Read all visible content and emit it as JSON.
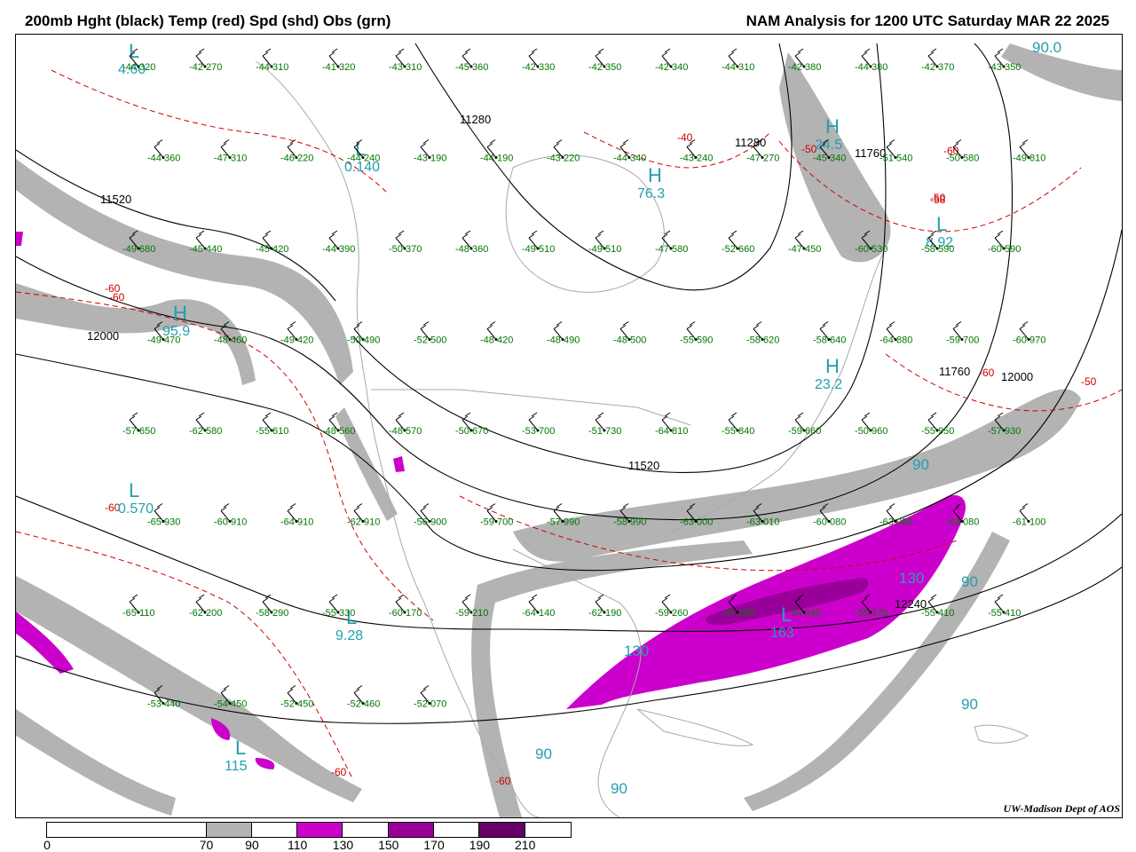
{
  "header": {
    "left_title": "200mb Hght (black) Temp (red) Spd (shd) Obs (grn)",
    "right_title": "NAM Analysis for 1200 UTC Saturday  MAR 22 2025"
  },
  "credit": "UW-Madison  Dept of AOS",
  "colors": {
    "height": "#000000",
    "temperature": "#cc0000",
    "obs": "#007700",
    "speed_label": "#22a0b0",
    "shade_70": "#b3b3b3",
    "shade_110": "#cc00cc",
    "shade_150": "#990099",
    "shade_190": "#660066",
    "geography": "#a8a8a8"
  },
  "colorbar": {
    "labels": [
      "0",
      "70",
      "90",
      "110",
      "130",
      "150",
      "170",
      "190",
      "210"
    ],
    "bins": [
      {
        "from": 0,
        "to": 70,
        "color": "#ffffff"
      },
      {
        "from": 70,
        "to": 90,
        "color": "#b3b3b3"
      },
      {
        "from": 90,
        "to": 110,
        "color": "#ffffff"
      },
      {
        "from": 110,
        "to": 130,
        "color": "#cc00cc"
      },
      {
        "from": 130,
        "to": 150,
        "color": "#ffffff"
      },
      {
        "from": 150,
        "to": 170,
        "color": "#990099"
      },
      {
        "from": 170,
        "to": 190,
        "color": "#ffffff"
      },
      {
        "from": 190,
        "to": 210,
        "color": "#660066"
      },
      {
        "from": 210,
        "to": 230,
        "color": "#ffffff"
      }
    ]
  },
  "height_labels": [
    "11280",
    "11280",
    "11520",
    "11520",
    "11760",
    "11760",
    "12000",
    "12000",
    "12240"
  ],
  "temp_labels": [
    "-60",
    "-60",
    "-60",
    "-60",
    "-60",
    "-60",
    "-50",
    "-50",
    "-40",
    "-50",
    "-58",
    "-60"
  ],
  "speed_labels": [
    "90.0",
    "90",
    "90",
    "90",
    "90",
    "130",
    "130",
    "90"
  ],
  "centers": [
    {
      "symbol": "L",
      "value": "4.60"
    },
    {
      "symbol": "L",
      "value": "0.140"
    },
    {
      "symbol": "L",
      "value": "0.570"
    },
    {
      "symbol": "L",
      "value": "9.28"
    },
    {
      "symbol": "L",
      "value": "8.92"
    },
    {
      "symbol": "L",
      "value": "115"
    },
    {
      "symbol": "L",
      "value": "163"
    },
    {
      "symbol": "H",
      "value": "95.9"
    },
    {
      "symbol": "H",
      "value": "24.5"
    },
    {
      "symbol": "H",
      "value": "76.3"
    },
    {
      "symbol": "H",
      "value": "23.2"
    }
  ],
  "obs": [
    "-44  320",
    "-42  270",
    "-44  310",
    "-41  320",
    "-43  310",
    "-45  360",
    "-42  330",
    "-42  350",
    "-42  340",
    "-44  310",
    "-42  380",
    "-44  380",
    "-42  370",
    "-43  350",
    "-44  360",
    "-47  310",
    "-46  220",
    "-44  240",
    "-43  190",
    "-44  190",
    "-43  220",
    "-44  340",
    "-43  240",
    "-47  270",
    "-45  340",
    "-51  540",
    "-50  580",
    "-49  810",
    "-49  680",
    "-45  440",
    "-45  420",
    "-44  390",
    "-50  370",
    "-48  360",
    "-49  510",
    "-49  510",
    "-47  580",
    "-52  660",
    "-47  450",
    "-60  530",
    "-58  590",
    "-60  590",
    "-49  470",
    "-48  460",
    "-49  420",
    "-50  490",
    "-52  500",
    "-48  420",
    "-48  490",
    "-48  500",
    "-55  590",
    "-58  620",
    "-58  640",
    "-64  880",
    "-59  700",
    "-60  970",
    "-57  650",
    "-62  580",
    "-55  610",
    "-48  560",
    "-48  570",
    "-50  670",
    "-53  700",
    "-51  730",
    "-64  810",
    "-55  840",
    "-59  660",
    "-50  960",
    "-55  950",
    "-57  930",
    "-65  930",
    "-60  910",
    "-64  910",
    "-62  910",
    "-56  900",
    "-59  700",
    "-57  990",
    "-58  990",
    "-63  000",
    "-63  010",
    "-60  080",
    "-63  080",
    "-63  080",
    "-61  100",
    "-65  110",
    "-62  200",
    "-58  290",
    "-55  330",
    "-60  170",
    "-59  210",
    "-64  140",
    "-62  190",
    "-59  260",
    "-57  280",
    "-54  340",
    "-55  370",
    "-55  410",
    "-55  410",
    "-53  440",
    "-54  450",
    "-52  450",
    "-52  460",
    "-52  070"
  ]
}
